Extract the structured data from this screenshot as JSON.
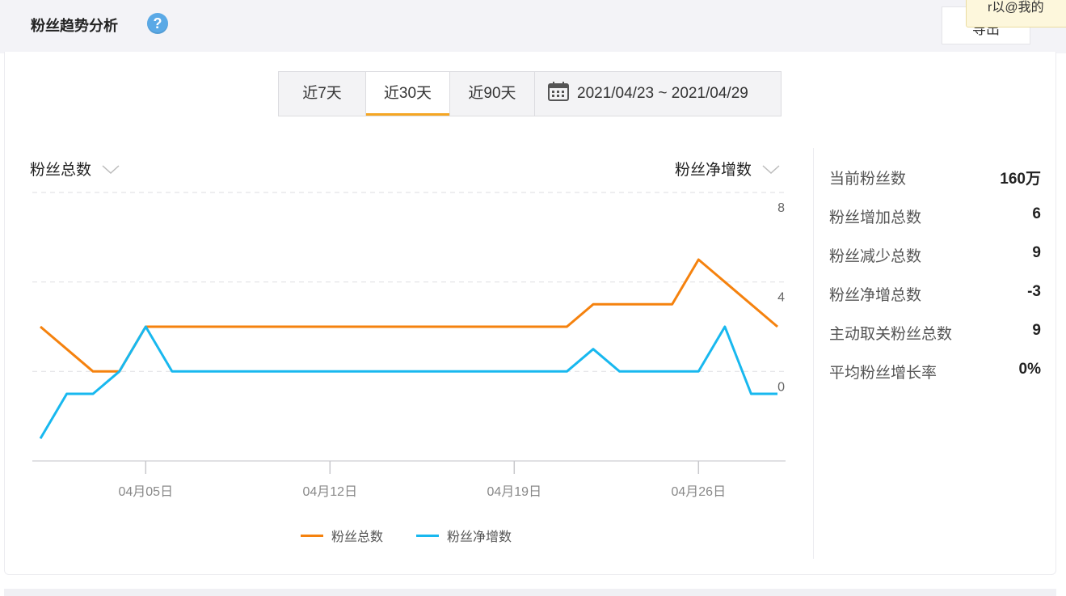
{
  "header": {
    "title": "粉丝趋势分析",
    "help_icon": "help-circle-icon",
    "export_label": "导出",
    "tooltip_text": "r以@我的"
  },
  "range_selector": {
    "options": [
      "近7天",
      "近30天",
      "近90天"
    ],
    "active_index": 1,
    "date_range": "2021/04/23 ~ 2021/04/29",
    "calendar_icon": "calendar-icon"
  },
  "chart_controls": {
    "left_metric": "粉丝总数",
    "right_metric": "粉丝净增数"
  },
  "chart_data": {
    "type": "line",
    "x": [
      "04/01",
      "04/02",
      "04/03",
      "04/04",
      "04/05",
      "04/06",
      "04/07",
      "04/08",
      "04/09",
      "04/10",
      "04/11",
      "04/12",
      "04/13",
      "04/14",
      "04/15",
      "04/16",
      "04/17",
      "04/18",
      "04/19",
      "04/20",
      "04/21",
      "04/22",
      "04/23",
      "04/24",
      "04/25",
      "04/26",
      "04/27",
      "04/28",
      "04/29"
    ],
    "x_tick_labels": [
      "04月05日",
      "04月12日",
      "04月19日",
      "04月26日"
    ],
    "y_right_ticks": [
      "8",
      "4",
      "0"
    ],
    "y_right_range": [
      -4,
      8
    ],
    "series": [
      {
        "name": "粉丝总数",
        "color": "#f5820e",
        "values": [
          2,
          1,
          0,
          0,
          2,
          2,
          2,
          2,
          2,
          2,
          2,
          2,
          2,
          2,
          2,
          2,
          2,
          2,
          2,
          2,
          2,
          3,
          3,
          3,
          3,
          5,
          4,
          3,
          2
        ],
        "range": [
          -4,
          8
        ]
      },
      {
        "name": "粉丝净增数",
        "color": "#18b8ef",
        "values": [
          -3,
          -1,
          -1,
          0,
          2,
          0,
          0,
          0,
          0,
          0,
          0,
          0,
          0,
          0,
          0,
          0,
          0,
          0,
          0,
          0,
          0,
          1,
          0,
          0,
          0,
          0,
          2,
          -1,
          -1
        ],
        "range": [
          -4,
          8
        ]
      }
    ],
    "grid": true,
    "legend_position": "bottom-center"
  },
  "stats": [
    {
      "label": "当前粉丝数",
      "value": "160万"
    },
    {
      "label": "粉丝增加总数",
      "value": "6"
    },
    {
      "label": "粉丝减少总数",
      "value": "9"
    },
    {
      "label": "粉丝净增总数",
      "value": "-3"
    },
    {
      "label": "主动取关粉丝总数",
      "value": "9"
    },
    {
      "label": "平均粉丝增长率",
      "value": "0%"
    }
  ]
}
